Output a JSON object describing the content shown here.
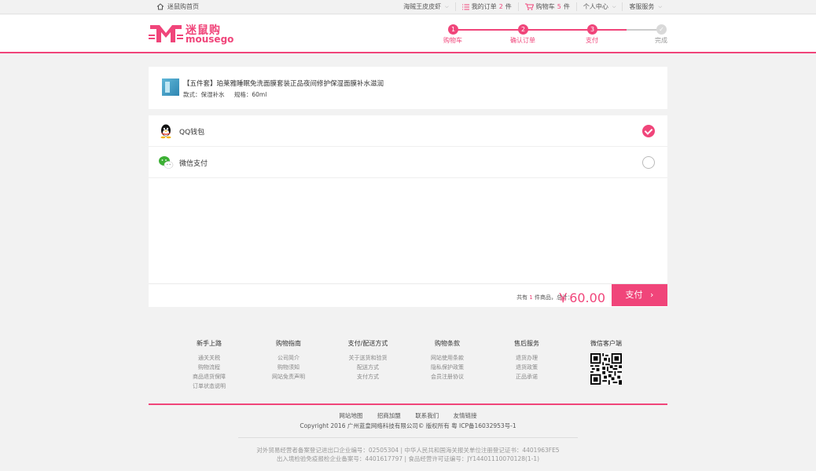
{
  "topbar": {
    "home": "迷鼠购首页",
    "username": "海贼王皮皮虾",
    "orders_prefix": "我的订单",
    "orders_count": "2",
    "orders_unit": "件",
    "cart_prefix": "购物车",
    "cart_count": "5",
    "cart_unit": "件",
    "user_center": "个人中心",
    "service": "客服服务"
  },
  "logo": {
    "cn": "迷鼠购",
    "en": "mousego"
  },
  "steps": [
    {
      "num": "1",
      "label": "购物车",
      "done": true
    },
    {
      "num": "2",
      "label": "确认订单",
      "done": true
    },
    {
      "num": "3",
      "label": "支付",
      "done": true
    },
    {
      "num": "✓",
      "label": "完成",
      "done": false
    }
  ],
  "product": {
    "title": "【五件套】珀莱雅睡眠免洗面膜套装正品夜间修护保湿面膜补水滋润",
    "style": "款式：保湿补水",
    "size": "规格：60ml"
  },
  "payment": {
    "methods": [
      {
        "name": "QQ钱包",
        "icon": "qq-penguin-icon",
        "selected": true
      },
      {
        "name": "微信支付",
        "icon": "wechat-icon",
        "selected": false
      }
    ],
    "summary_pre": "共有",
    "summary_count": "1",
    "summary_post": "件商品，总计：",
    "amount": "￥60.00",
    "pay_button": "支付"
  },
  "footer": {
    "columns": [
      {
        "title": "新手上路",
        "links": [
          "通关关税",
          "购物流程",
          "商品退货保障",
          "订单状态说明"
        ]
      },
      {
        "title": "购物指南",
        "links": [
          "公司简介",
          "购物须知",
          "网站免责声明"
        ]
      },
      {
        "title": "支付/配送方式",
        "links": [
          "关于送货和验货",
          "配送方式",
          "支付方式"
        ]
      },
      {
        "title": "购物条款",
        "links": [
          "网站使用条款",
          "隐私保护政策",
          "会员注册协议"
        ]
      },
      {
        "title": "售后服务",
        "links": [
          "退货办理",
          "退货政策",
          "正品承诺"
        ]
      },
      {
        "title": "微信客户端",
        "links": []
      }
    ],
    "links": [
      "网站地图",
      "招商加盟",
      "联系我们",
      "友情链接"
    ],
    "copyright": "Copyright 2016 广州蓝皇网络科技有限公司© 版权所有 粤 ICP备16032953号-1",
    "license1": "对外贸易经营者备案登记进出口企业编号：02505304 | 中华人民共和国海关报关单位注册登记证书：4401963FE5",
    "license2": "出入境检验免疫报检企业备案号：4401617797 | 食品经营许可证编号：JY14401110070128(1-1)"
  },
  "colors": {
    "accent": "#f0457a"
  }
}
